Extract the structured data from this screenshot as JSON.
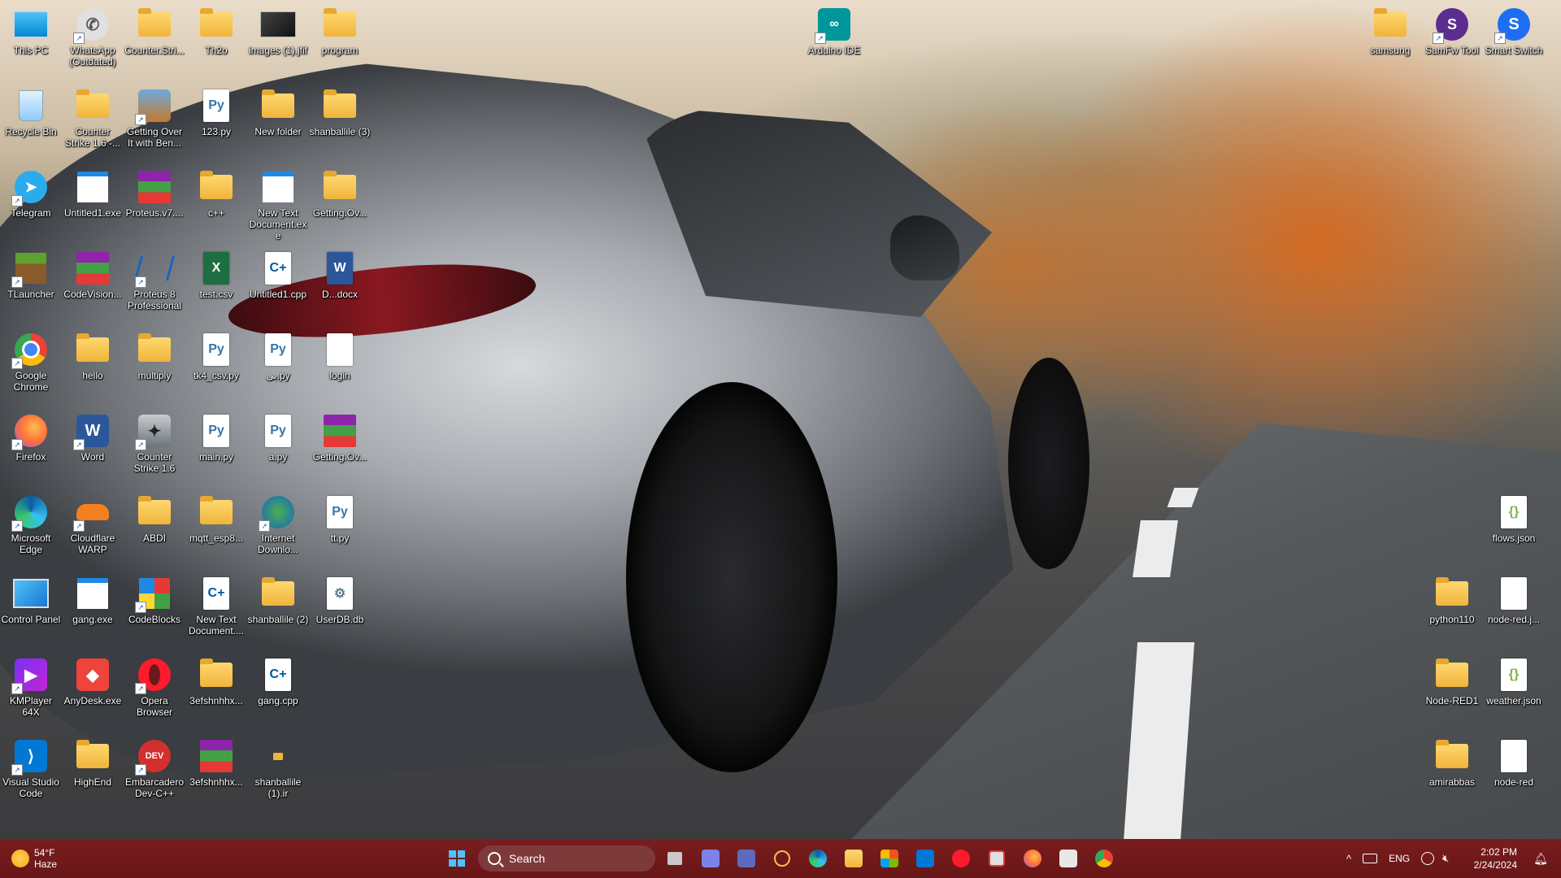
{
  "desktop": {
    "icons": [
      {
        "label": "This PC"
      },
      {
        "label": "WhatsApp (Outdated)"
      },
      {
        "label": "Counter.Stri..."
      },
      {
        "label": "Th2o"
      },
      {
        "label": "images (1).jfif"
      },
      {
        "label": "program"
      },
      {
        "label": "Arduino IDE"
      },
      {
        "label": "samsung"
      },
      {
        "label": "SamFw Tool"
      },
      {
        "label": "Smart Switch"
      },
      {
        "label": "Recycle Bin"
      },
      {
        "label": "Counter Strike 1.6 -..."
      },
      {
        "label": "Getting Over It with Ben..."
      },
      {
        "label": "123.py"
      },
      {
        "label": "New folder"
      },
      {
        "label": "shanballile (3)"
      },
      {
        "label": "Telegram"
      },
      {
        "label": "Untitled1.exe"
      },
      {
        "label": "Proteus.v7...."
      },
      {
        "label": "c++"
      },
      {
        "label": "New Text Document.ex e"
      },
      {
        "label": "Getting.Ov..."
      },
      {
        "label": "TLauncher"
      },
      {
        "label": "CodeVision..."
      },
      {
        "label": "Proteus 8 Professional"
      },
      {
        "label": "test.csv"
      },
      {
        "label": "Untitled1.cpp"
      },
      {
        "label": "D...docx"
      },
      {
        "label": "Google Chrome"
      },
      {
        "label": "hello"
      },
      {
        "label": "multiply"
      },
      {
        "label": "tk4_csv.py"
      },
      {
        "label": "بی.py"
      },
      {
        "label": "login"
      },
      {
        "label": "Firefox"
      },
      {
        "label": "Word"
      },
      {
        "label": "Counter Strike 1.6"
      },
      {
        "label": "main.py"
      },
      {
        "label": "a.py"
      },
      {
        "label": "Getting.Ov..."
      },
      {
        "label": "Microsoft Edge"
      },
      {
        "label": "Cloudflare WARP"
      },
      {
        "label": "ABDI"
      },
      {
        "label": "mqtt_esp8..."
      },
      {
        "label": "Internet Downlo..."
      },
      {
        "label": "tt.py"
      },
      {
        "label": "flows.json"
      },
      {
        "label": "Control Panel"
      },
      {
        "label": "gang.exe"
      },
      {
        "label": "CodeBlocks"
      },
      {
        "label": "New Text Document...."
      },
      {
        "label": "shanballile (2)"
      },
      {
        "label": "UserDB.db"
      },
      {
        "label": "python110"
      },
      {
        "label": "node-red.j..."
      },
      {
        "label": "KMPlayer 64X"
      },
      {
        "label": "AnyDesk.exe"
      },
      {
        "label": "Opera Browser"
      },
      {
        "label": "3efshnhhx..."
      },
      {
        "label": "gang.cpp"
      },
      {
        "label": "Node-RED1"
      },
      {
        "label": "weather.json"
      },
      {
        "label": "Visual Studio Code"
      },
      {
        "label": "HighEnd"
      },
      {
        "label": "Embarcadero Dev-C++"
      },
      {
        "label": "3efshnhhx..."
      },
      {
        "label": "shanballile (1).ir"
      },
      {
        "label": "amirabbas"
      },
      {
        "label": "node-red"
      }
    ]
  },
  "taskbar": {
    "weather": {
      "temp": "54°F",
      "condition": "Haze"
    },
    "search_label": "Search",
    "tray": {
      "language": "ENG",
      "time": "2:02 PM",
      "date": "2/24/2024",
      "up_arrow": "^"
    }
  },
  "colors": {
    "taskbar": "#6b1a1a",
    "accent": "#0078d4"
  }
}
